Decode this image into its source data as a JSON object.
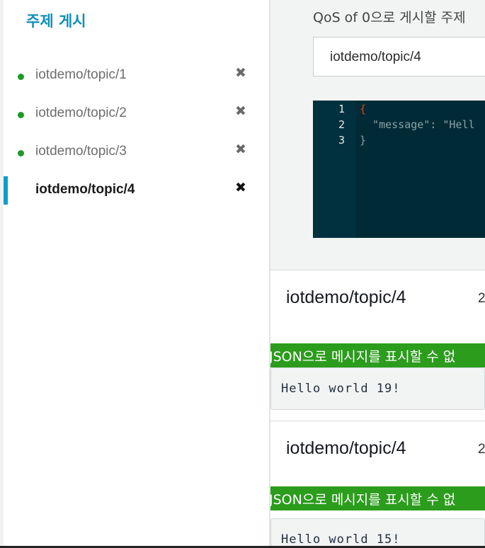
{
  "sidebar": {
    "title": "주제 게시",
    "topics": [
      {
        "label": "iotdemo/topic/1",
        "status_color": "#1d9a2a"
      },
      {
        "label": "iotdemo/topic/2",
        "status_color": "#1d9a2a"
      },
      {
        "label": "iotdemo/topic/3",
        "status_color": "#1d9a2a"
      },
      {
        "label": "iotdemo/topic/4",
        "active": true
      }
    ],
    "close_glyph": "✖"
  },
  "publish": {
    "qos_text": "QoS of 0으로 게시할 주제",
    "topic_value": "iotdemo/topic/4",
    "editor": {
      "line_numbers": [
        "1",
        "2",
        "3"
      ],
      "lines": [
        "{",
        "  \"message\": \"Hell",
        "}"
      ]
    }
  },
  "messages": [
    {
      "topic": "iotdemo/topic/4",
      "time": "2",
      "warning": "JSON으로 메시지를 표시할 수 없",
      "body": "Hello world 19!"
    },
    {
      "topic": "iotdemo/topic/4",
      "time": "2",
      "warning": "JSON으로 메시지를 표시할 수 없",
      "body": "Hello world 15!"
    }
  ],
  "colors": {
    "accent": "#0e8fb5",
    "active_bar": "#00a1c9",
    "connected": "#1d9a2a",
    "warning_banner": "#2c9c1d",
    "editor_bg": "#002b36"
  }
}
